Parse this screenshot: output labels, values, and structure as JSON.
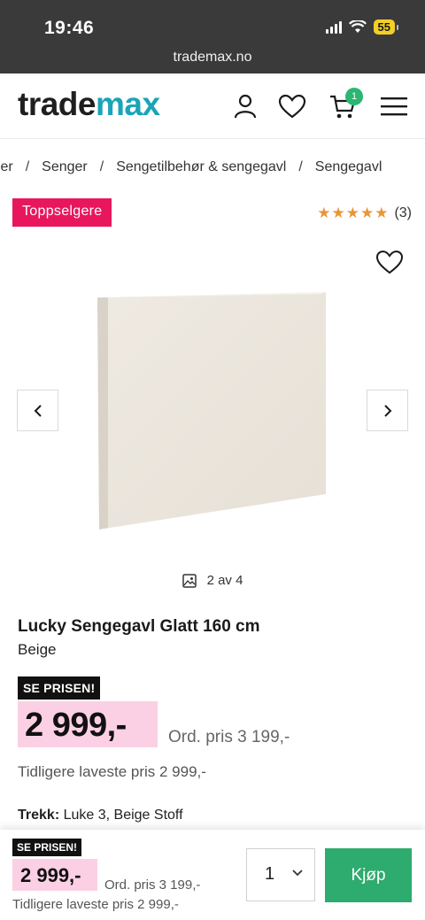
{
  "status_bar": {
    "time": "19:46",
    "battery": "55",
    "icons": [
      "signal-icon",
      "wifi-icon",
      "battery-icon"
    ]
  },
  "browser": {
    "url": "trademax.no"
  },
  "header": {
    "logo_part1": "trade",
    "logo_part2": "max",
    "cart_count": "1",
    "icons": [
      "user-icon",
      "heart-icon",
      "cart-icon",
      "menu-icon"
    ],
    "colors": {
      "logo_dark": "#1f1f1f",
      "logo_accent": "#1aa4b8",
      "badge_green": "#2bb673"
    }
  },
  "breadcrumb": {
    "items": [
      "bler",
      "Senger",
      "Sengetilbehør & sengegavl",
      "Sengegavl"
    ],
    "separator": "/"
  },
  "product": {
    "badge": "Toppselgere",
    "rating_count": "(3)",
    "rating_stars": 5,
    "image_counter": "2 av 4",
    "title": "Lucky Sengegavl Glatt 160 cm",
    "color": "Beige",
    "price_tag": "SE PRISEN!",
    "price": "2 999,-",
    "ord_price": "Ord. pris 3 199,-",
    "lowest_price": "Tidligere laveste pris 2 999,-",
    "trekk_label": "Trekk:",
    "trekk_value": "Luke 3, Beige Stoff",
    "colors": {
      "badge_pink": "#e8175d",
      "price_bg": "#fbd0e4",
      "star_orange": "#e8963a"
    }
  },
  "sticky_bar": {
    "price_tag": "SE PRISEN!",
    "price": "2 999,-",
    "ord_price": "Ord. pris 3 199,-",
    "lowest_price": "Tidligere laveste pris 2 999,-",
    "quantity": "1",
    "buy_label": "Kjøp",
    "colors": {
      "buy_green": "#2eab6e"
    }
  }
}
